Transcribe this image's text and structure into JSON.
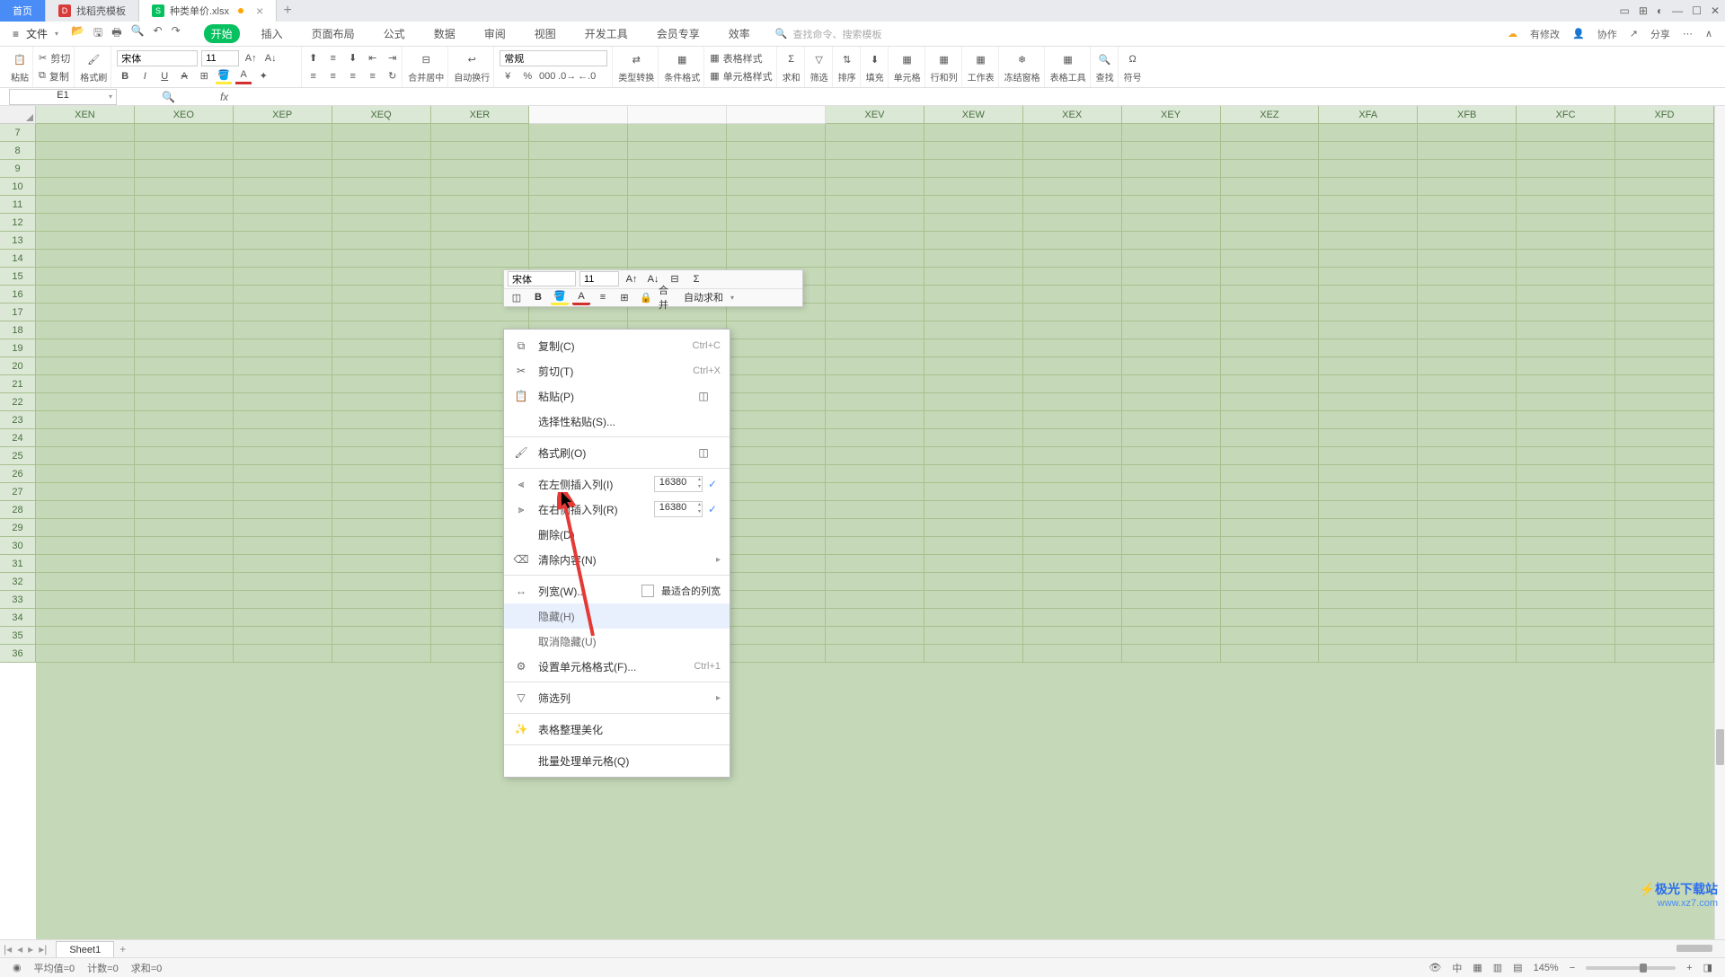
{
  "tabs": {
    "home": "首页",
    "template": "找稻壳模板",
    "file": "种类单价.xlsx"
  },
  "menu": {
    "file": "文件",
    "tabs": [
      "开始",
      "插入",
      "页面布局",
      "公式",
      "数据",
      "审阅",
      "视图",
      "开发工具",
      "会员专享",
      "效率"
    ],
    "active_index": 0,
    "search_placeholder": "查找命令、搜索模板",
    "right": {
      "track": "有修改",
      "collab": "协作",
      "share": "分享"
    }
  },
  "ribbon": {
    "paste": "粘贴",
    "cut": "剪切",
    "copy": "复制",
    "format_painter": "格式刷",
    "font": "宋体",
    "font_size": "11",
    "merge_center": "合并居中",
    "wrap": "自动换行",
    "number_format": "常规",
    "type_convert": "类型转换",
    "cond_format": "条件格式",
    "table_style": "表格样式",
    "cell_style": "单元格样式",
    "sum": "求和",
    "filter": "筛选",
    "sort": "排序",
    "fill": "填充",
    "cells": "单元格",
    "rowcol": "行和列",
    "worksheet": "工作表",
    "freeze": "冻结窗格",
    "table_tools": "表格工具",
    "find": "查找",
    "symbol": "符号"
  },
  "name_box": "E1",
  "columns": [
    "XEN",
    "XEO",
    "XEP",
    "XEQ",
    "XER",
    "",
    "",
    "",
    "XEV",
    "XEW",
    "XEX",
    "XEY",
    "XEZ",
    "XFA",
    "XFB",
    "XFC",
    "XFD"
  ],
  "rows": [
    7,
    8,
    9,
    10,
    11,
    12,
    13,
    14,
    15,
    16,
    17,
    18,
    19,
    20,
    21,
    22,
    23,
    24,
    25,
    26,
    27,
    28,
    29,
    30,
    31,
    32,
    33,
    34,
    35,
    36
  ],
  "mini": {
    "font": "宋体",
    "size": "11",
    "merge": "合并",
    "autosum": "自动求和"
  },
  "context_menu": {
    "copy": "复制(C)",
    "copy_sc": "Ctrl+C",
    "cut": "剪切(T)",
    "cut_sc": "Ctrl+X",
    "paste": "粘贴(P)",
    "paste_special": "选择性粘贴(S)...",
    "format_painter": "格式刷(O)",
    "insert_left": "在左侧插入列(I)",
    "insert_left_val": "16380",
    "insert_right": "在右侧插入列(R)",
    "insert_right_val": "16380",
    "delete": "删除(D)",
    "clear": "清除内容(N)",
    "col_width": "列宽(W)...",
    "best_fit": "最适合的列宽",
    "hide": "隐藏(H)",
    "unhide": "取消隐藏(U)",
    "format_cells": "设置单元格格式(F)...",
    "format_cells_sc": "Ctrl+1",
    "filter_col": "筛选列",
    "beautify": "表格整理美化",
    "batch": "批量处理单元格(Q)"
  },
  "sheet": {
    "name": "Sheet1"
  },
  "status": {
    "avg": "平均值=0",
    "count": "计数=0",
    "sum": "求和=0",
    "zoom": "145%"
  },
  "watermark": {
    "title": "极光下载站",
    "url": "www.xz7.com"
  }
}
